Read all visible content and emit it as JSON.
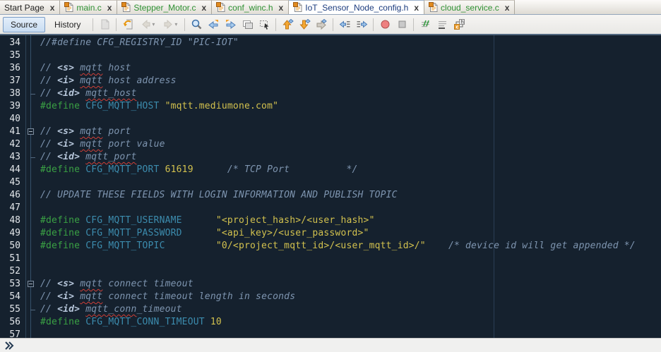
{
  "tabs": [
    {
      "label": "Start Page",
      "type": "start",
      "active": false
    },
    {
      "label": "main.c",
      "type": "c",
      "active": false
    },
    {
      "label": "Stepper_Motor.c",
      "type": "c",
      "active": false
    },
    {
      "label": "conf_winc.h",
      "type": "h",
      "active": false
    },
    {
      "label": "IoT_Sensor_Node_config.h",
      "type": "h",
      "active": true
    },
    {
      "label": "cloud_service.c",
      "type": "c",
      "active": false
    }
  ],
  "tab_close_glyph": "x",
  "toolbar": {
    "source_label": "Source",
    "history_label": "History",
    "groups": [
      {
        "items": [
          {
            "icon": "last-edited-document-icon",
            "disabled": true
          }
        ]
      },
      {
        "items": [
          {
            "icon": "back-to-last-edit-icon"
          },
          {
            "icon": "nav-back-icon",
            "disabled": true,
            "caret": true
          },
          {
            "icon": "nav-forward-icon",
            "disabled": true,
            "caret": true
          }
        ]
      },
      {
        "items": [
          {
            "icon": "find-selection-icon"
          },
          {
            "icon": "find-previous-occurrence-icon"
          },
          {
            "icon": "find-next-occurrence-icon"
          },
          {
            "icon": "toggle-highlight-search-icon"
          },
          {
            "icon": "rectangular-selection-icon"
          }
        ]
      },
      {
        "items": [
          {
            "icon": "previous-bookmark-icon"
          },
          {
            "icon": "next-bookmark-icon"
          },
          {
            "icon": "toggle-bookmark-icon"
          }
        ]
      },
      {
        "items": [
          {
            "icon": "shift-line-left-icon"
          },
          {
            "icon": "shift-line-right-icon"
          }
        ]
      },
      {
        "items": [
          {
            "icon": "start-macro-recording-icon"
          },
          {
            "icon": "stop-macro-recording-icon"
          }
        ]
      },
      {
        "items": [
          {
            "icon": "comment-icon"
          },
          {
            "icon": "uncomment-icon"
          },
          {
            "icon": "toggle-header-source-icon"
          }
        ]
      }
    ]
  },
  "colors": {
    "editor_bg": "#15212e",
    "comment": "#7e95b0",
    "doc_tag": "#b6c6da",
    "directive": "#3aa144",
    "macro": "#3c8cae",
    "literal": "#d2c14e",
    "line_number": "#e2e6ea",
    "squiggle": "#d04038",
    "margin_guide": "#2a3e55",
    "tab_active_text": "#1c3c7e",
    "tab_file_text": "#2e9133"
  },
  "editor": {
    "first_line": 34,
    "last_line": 57,
    "lines": [
      {
        "n": 34,
        "fold": "",
        "segs": [
          {
            "t": "//#define CFG_REGISTRY_ID \"PIC-IOT\"",
            "c": "c"
          }
        ]
      },
      {
        "n": 35,
        "fold": "",
        "segs": []
      },
      {
        "n": 36,
        "fold": "",
        "segs": [
          {
            "t": "// ",
            "c": "c"
          },
          {
            "t": "<s>",
            "c": "t"
          },
          {
            "t": " ",
            "c": "c"
          },
          {
            "t": "mqtt",
            "c": "c",
            "sq": true
          },
          {
            "t": " host",
            "c": "c"
          }
        ]
      },
      {
        "n": 37,
        "fold": "",
        "segs": [
          {
            "t": "// ",
            "c": "c"
          },
          {
            "t": "<i>",
            "c": "t"
          },
          {
            "t": " ",
            "c": "c"
          },
          {
            "t": "mqtt",
            "c": "c",
            "sq": true
          },
          {
            "t": " host address",
            "c": "c"
          }
        ]
      },
      {
        "n": 38,
        "fold": "tick",
        "segs": [
          {
            "t": "// ",
            "c": "c"
          },
          {
            "t": "<id>",
            "c": "t"
          },
          {
            "t": " ",
            "c": "c"
          },
          {
            "t": "mqtt_host",
            "c": "c",
            "sq": true
          }
        ]
      },
      {
        "n": 39,
        "fold": "",
        "segs": [
          {
            "t": "#define ",
            "c": "d"
          },
          {
            "t": "CFG_MQTT_HOST ",
            "c": "m"
          },
          {
            "t": "\"mqtt.mediumone.com\"",
            "c": "v"
          }
        ]
      },
      {
        "n": 40,
        "fold": "",
        "segs": []
      },
      {
        "n": 41,
        "fold": "box",
        "segs": [
          {
            "t": "// ",
            "c": "c"
          },
          {
            "t": "<s>",
            "c": "t"
          },
          {
            "t": " ",
            "c": "c"
          },
          {
            "t": "mqtt",
            "c": "c",
            "sq": true
          },
          {
            "t": " port",
            "c": "c"
          }
        ]
      },
      {
        "n": 42,
        "fold": "",
        "segs": [
          {
            "t": "// ",
            "c": "c"
          },
          {
            "t": "<i>",
            "c": "t"
          },
          {
            "t": " ",
            "c": "c"
          },
          {
            "t": "mqtt",
            "c": "c",
            "sq": true
          },
          {
            "t": " port value",
            "c": "c"
          }
        ]
      },
      {
        "n": 43,
        "fold": "tick",
        "segs": [
          {
            "t": "// ",
            "c": "c"
          },
          {
            "t": "<id>",
            "c": "t"
          },
          {
            "t": " ",
            "c": "c"
          },
          {
            "t": "mqtt_port",
            "c": "c",
            "sq": true
          }
        ]
      },
      {
        "n": 44,
        "fold": "",
        "segs": [
          {
            "t": "#define ",
            "c": "d"
          },
          {
            "t": "CFG_MQTT_PORT ",
            "c": "m"
          },
          {
            "t": "61619",
            "c": "v"
          },
          {
            "t": "      ",
            "c": "p"
          },
          {
            "t": "/* TCP Port          */",
            "c": "c"
          }
        ]
      },
      {
        "n": 45,
        "fold": "",
        "segs": []
      },
      {
        "n": 46,
        "fold": "",
        "segs": [
          {
            "t": "// UPDATE THESE FIELDS WITH LOGIN INFORMATION AND PUBLISH TOPIC",
            "c": "c"
          }
        ]
      },
      {
        "n": 47,
        "fold": "",
        "segs": []
      },
      {
        "n": 48,
        "fold": "",
        "segs": [
          {
            "t": "#define ",
            "c": "d"
          },
          {
            "t": "CFG_MQTT_USERNAME",
            "c": "m"
          },
          {
            "t": "      ",
            "c": "p"
          },
          {
            "t": "\"<project_hash>/<user_hash>\"",
            "c": "v"
          }
        ]
      },
      {
        "n": 49,
        "fold": "",
        "segs": [
          {
            "t": "#define ",
            "c": "d"
          },
          {
            "t": "CFG_MQTT_PASSWORD",
            "c": "m"
          },
          {
            "t": "      ",
            "c": "p"
          },
          {
            "t": "\"<api_key>/<user_password>\"",
            "c": "v"
          }
        ]
      },
      {
        "n": 50,
        "fold": "",
        "segs": [
          {
            "t": "#define ",
            "c": "d"
          },
          {
            "t": "CFG_MQTT_TOPIC",
            "c": "m"
          },
          {
            "t": "         ",
            "c": "p"
          },
          {
            "t": "\"0/<project_mqtt_id>/<user_mqtt_id>/\"",
            "c": "v"
          },
          {
            "t": "    ",
            "c": "p"
          },
          {
            "t": "/* device id will get appended */",
            "c": "c"
          }
        ]
      },
      {
        "n": 51,
        "fold": "",
        "segs": []
      },
      {
        "n": 52,
        "fold": "",
        "segs": []
      },
      {
        "n": 53,
        "fold": "box",
        "segs": [
          {
            "t": "// ",
            "c": "c"
          },
          {
            "t": "<s>",
            "c": "t"
          },
          {
            "t": " ",
            "c": "c"
          },
          {
            "t": "mqtt",
            "c": "c",
            "sq": true
          },
          {
            "t": " connect timeout",
            "c": "c"
          }
        ]
      },
      {
        "n": 54,
        "fold": "",
        "segs": [
          {
            "t": "// ",
            "c": "c"
          },
          {
            "t": "<i>",
            "c": "t"
          },
          {
            "t": " ",
            "c": "c"
          },
          {
            "t": "mqtt",
            "c": "c",
            "sq": true
          },
          {
            "t": " connect timeout length in seconds",
            "c": "c"
          }
        ]
      },
      {
        "n": 55,
        "fold": "tick",
        "segs": [
          {
            "t": "// ",
            "c": "c"
          },
          {
            "t": "<id>",
            "c": "t"
          },
          {
            "t": " ",
            "c": "c"
          },
          {
            "t": "mqtt_conn",
            "c": "c",
            "sq": true
          },
          {
            "t": "_timeout",
            "c": "c"
          }
        ]
      },
      {
        "n": 56,
        "fold": "",
        "segs": [
          {
            "t": "#define ",
            "c": "d"
          },
          {
            "t": "CFG_MQTT_CONN_TIMEOUT ",
            "c": "m"
          },
          {
            "t": "10",
            "c": "v"
          }
        ]
      },
      {
        "n": 57,
        "fold": "",
        "segs": []
      }
    ]
  },
  "bottom_bar": {
    "icon": "expand-chevron-icon"
  }
}
